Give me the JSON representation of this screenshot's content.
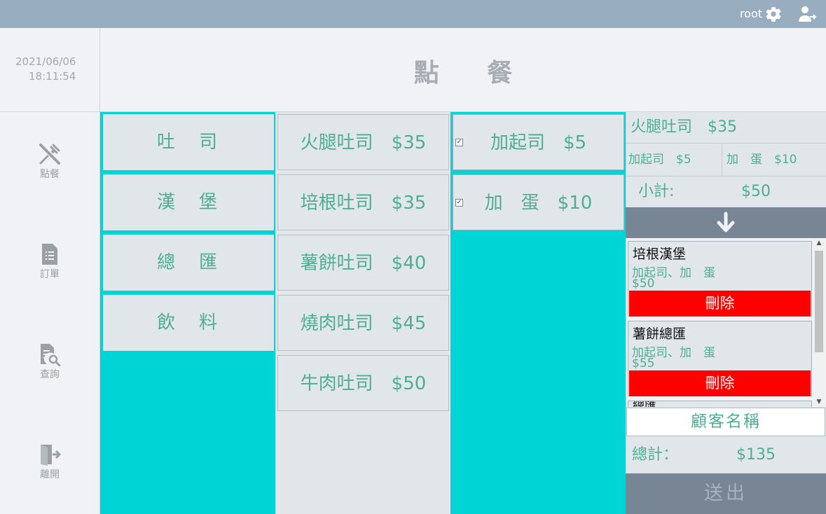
{
  "topbar": {
    "username": "root",
    "settings_icon": "gear-icon",
    "logout_icon": "logout-icon"
  },
  "sidebar": {
    "date": "2021/06/06",
    "time": "18:11:54",
    "items": [
      {
        "label": "點餐",
        "icon": "utensils-icon"
      },
      {
        "label": "訂單",
        "icon": "document-icon"
      },
      {
        "label": "查詢",
        "icon": "search-document-icon"
      },
      {
        "label": "離開",
        "icon": "exit-icon"
      }
    ]
  },
  "header": {
    "title": "點 餐"
  },
  "categories": [
    "吐　司",
    "漢　堡",
    "總　匯",
    "飲　料"
  ],
  "items": [
    "火腿吐司　$35",
    "培根吐司　$35",
    "薯餅吐司　$40",
    "燒肉吐司　$45",
    "牛肉吐司　$50"
  ],
  "options": [
    {
      "label": "加起司　$5",
      "checked": true
    },
    {
      "label": "加　蛋　$10",
      "checked": true
    }
  ],
  "current": {
    "name": "火腿吐司　$35",
    "option1": "加起司　$5",
    "option2": "加　蛋　$10",
    "subtotal_label": "小計:",
    "subtotal_value": "$50"
  },
  "orders": [
    {
      "name": "培根漢堡",
      "options": "加起司、加　蛋",
      "price": "$50",
      "delete": "刪除"
    },
    {
      "name": "薯餅總匯",
      "options": "加起司、加　蛋",
      "price": "$55",
      "delete": "刪除"
    },
    {
      "name": "總匯"
    }
  ],
  "customer_placeholder": "顧客名稱",
  "total": {
    "label": "總計：",
    "value": "$135"
  },
  "submit_label": "送出",
  "colors": {
    "accent": "#00d4d4",
    "text_green": "#4eae94",
    "delete_red": "#ff0000",
    "topbar": "#98adc0",
    "dark_bar": "#778595"
  }
}
